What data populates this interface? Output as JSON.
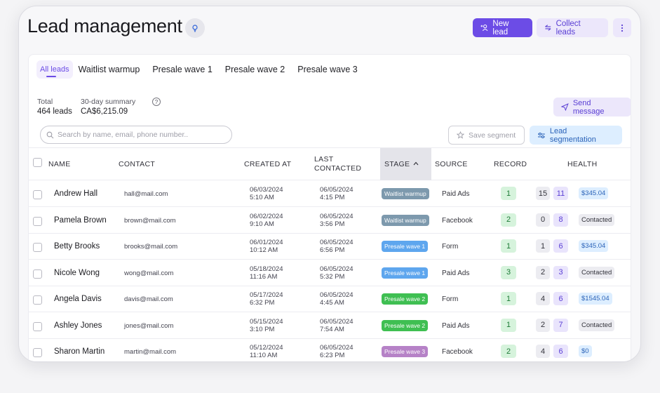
{
  "header": {
    "title": "Lead management",
    "new_lead": "New lead",
    "collect_leads": "Collect leads"
  },
  "tabs": [
    "All leads",
    "Waitlist warmup",
    "Presale wave 1",
    "Presale wave 2",
    "Presale wave 3"
  ],
  "summary": {
    "total_label": "Total",
    "total_value": "464 leads",
    "summary_label": "30-day summary",
    "summary_value": "CA$6,215.09"
  },
  "toolbar": {
    "send_message": "Send message",
    "search_placeholder": "Search by name, email, phone number..",
    "save_segment": "Save segment",
    "lead_segmentation": "Lead segmentation"
  },
  "columns": {
    "name": "NAME",
    "contact": "CONTACT",
    "created": "CREATED AT",
    "last1": "LAST",
    "last2": "CONTACTED",
    "stage": "STAGE",
    "source": "SOURCE",
    "record": "RECORD",
    "health": "HEALTH"
  },
  "rows": [
    {
      "name": "Andrew Hall",
      "contact": "hall@mail.com",
      "created_date": "06/03/2024",
      "created_time": "5:10 AM",
      "last_date": "06/05/2024",
      "last_time": "4:15 PM",
      "stage": "Waitlist warmup",
      "source": "Paid Ads",
      "record": "1",
      "h1": "15",
      "h2": "11",
      "health": "$345.04"
    },
    {
      "name": "Pamela Brown",
      "contact": "brown@mail.com",
      "created_date": "06/02/2024",
      "created_time": "9:10 AM",
      "last_date": "06/05/2024",
      "last_time": "3:56 PM",
      "stage": "Waitlist warmup",
      "source": "Facebook",
      "record": "2",
      "h1": "0",
      "h2": "8",
      "health": "Contacted"
    },
    {
      "name": "Betty Brooks",
      "contact": "brooks@mail.com",
      "created_date": "06/01/2024",
      "created_time": "10:12 AM",
      "last_date": "06/05/2024",
      "last_time": "6:56 PM",
      "stage": "Presale wave 1",
      "source": "Form",
      "record": "1",
      "h1": "1",
      "h2": "6",
      "health": "$345.04"
    },
    {
      "name": "Nicole Wong",
      "contact": "wong@mail.com",
      "created_date": "05/18/2024",
      "created_time": "11:16 AM",
      "last_date": "06/05/2024",
      "last_time": "5:32 PM",
      "stage": "Presale wave 1",
      "source": "Paid Ads",
      "record": "3",
      "h1": "2",
      "h2": "3",
      "health": "Contacted"
    },
    {
      "name": "Angela Davis",
      "contact": "davis@mail.com",
      "created_date": "05/17/2024",
      "created_time": "6:32 PM",
      "last_date": "06/05/2024",
      "last_time": "4:45 AM",
      "stage": "Presale wave 2",
      "source": "Form",
      "record": "1",
      "h1": "4",
      "h2": "6",
      "health": "$1545.04"
    },
    {
      "name": "Ashley Jones",
      "contact": "jones@mail.com",
      "created_date": "05/15/2024",
      "created_time": "3:10 PM",
      "last_date": "06/05/2024",
      "last_time": "7:54 AM",
      "stage": "Presale wave 2",
      "source": "Paid Ads",
      "record": "1",
      "h1": "2",
      "h2": "7",
      "health": "Contacted"
    },
    {
      "name": "Sharon Martin",
      "contact": "martin@mail.com",
      "created_date": "05/12/2024",
      "created_time": "11:10 AM",
      "last_date": "06/05/2024",
      "last_time": "6:23 PM",
      "stage": "Presale wave 3",
      "source": "Facebook",
      "record": "2",
      "h1": "4",
      "h2": "6",
      "health": "$0"
    }
  ],
  "colors": {
    "accent": "#6c4ce6",
    "stage_waitlist": "#7d99ad",
    "stage_presale1": "#5ea6ee",
    "stage_presale2": "#3fbf52",
    "stage_presale3": "#b682c7"
  }
}
